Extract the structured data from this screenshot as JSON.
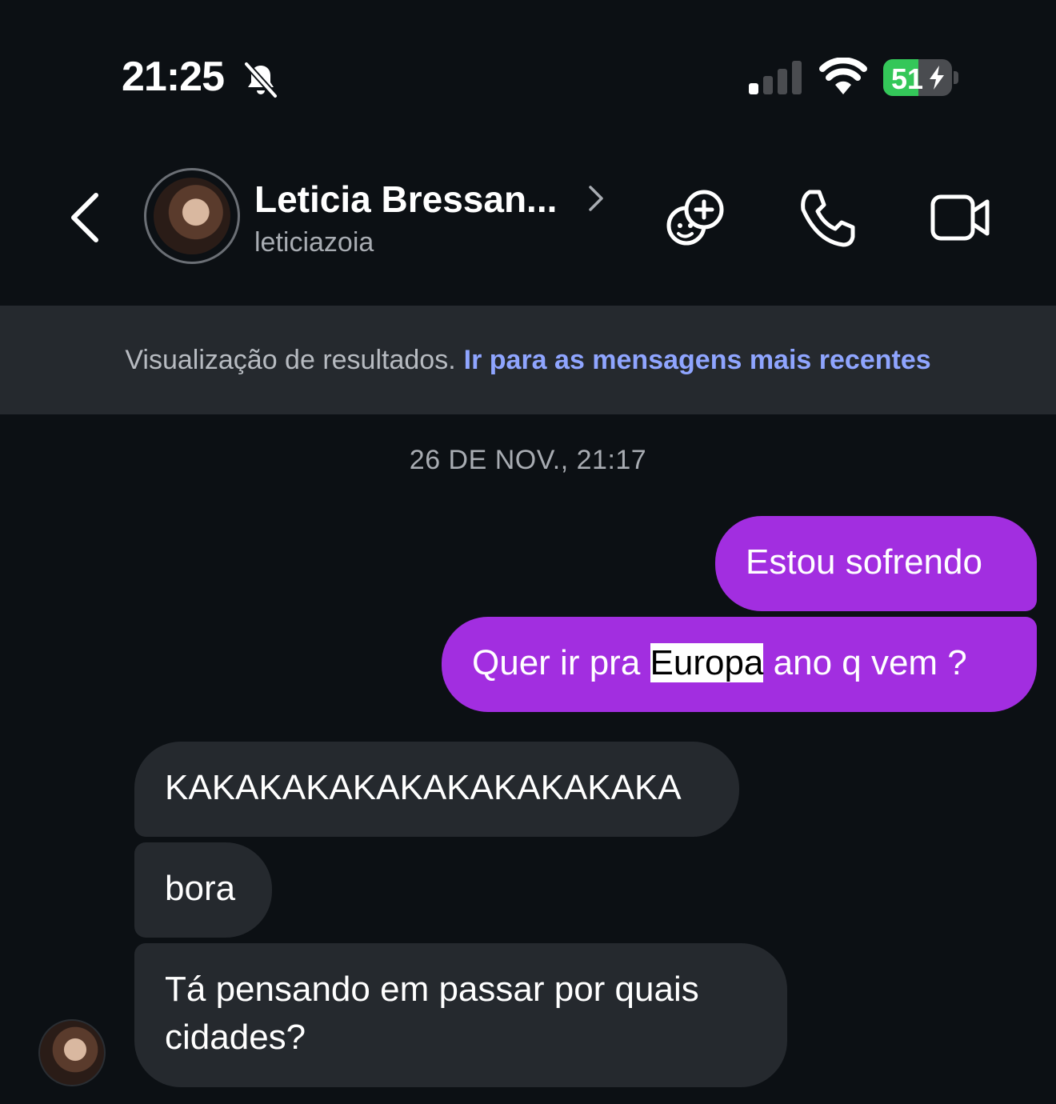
{
  "status_bar": {
    "time": "21:25",
    "battery_level": "51",
    "battery_percent": 51,
    "signal_bars_active": 1,
    "signal_bars_total": 4,
    "icons": [
      "bell-slash-icon",
      "cellular-signal-icon",
      "wifi-icon",
      "battery-charging-icon"
    ]
  },
  "header": {
    "contact_name": "Leticia Bressan...",
    "username": "leticiazoia",
    "icons": [
      "back-chevron-icon",
      "chevron-right-icon",
      "add-people-icon",
      "phone-icon",
      "video-camera-icon"
    ]
  },
  "banner": {
    "text": "Visualização de resultados.",
    "link": "Ir para as mensagens mais recentes"
  },
  "chat": {
    "date_stamp": "26 DE NOV., 21:17",
    "messages": [
      {
        "direction": "outgoing",
        "text": "Estou sofrendo"
      },
      {
        "direction": "outgoing",
        "text_before": "Quer ir pra ",
        "highlight": "Europa",
        "text_after": " ano q vem ?"
      },
      {
        "direction": "incoming",
        "text": "KAKAKAKAKAKAKAKAKAKAKA"
      },
      {
        "direction": "incoming",
        "text": "bora"
      },
      {
        "direction": "incoming",
        "text": "Tá pensando em passar por quais cidades?"
      }
    ]
  },
  "colors": {
    "background": "#0c1014",
    "outgoing_bubble": "#a22ee0",
    "incoming_bubble": "#25292e",
    "banner_background": "#25292e",
    "link": "#8fa5ff",
    "battery_fill": "#34c759"
  }
}
